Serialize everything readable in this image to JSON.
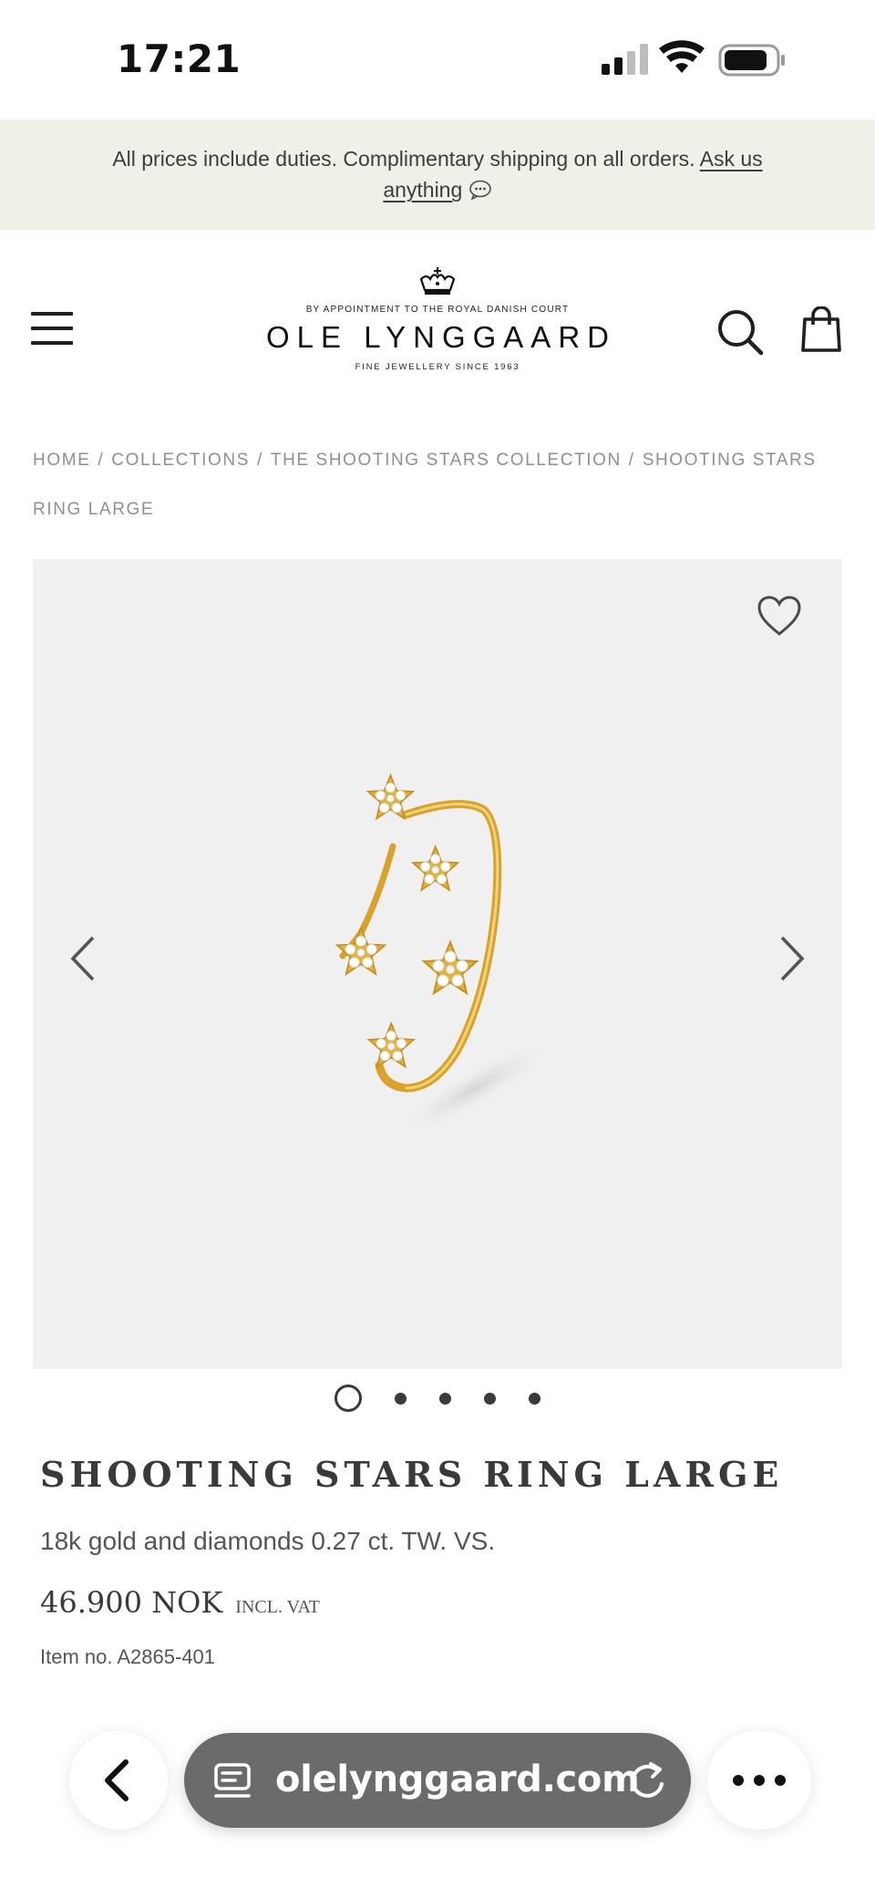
{
  "status_bar": {
    "time": "17:21",
    "icons": [
      "cellular-signal-icon",
      "wifi-icon",
      "battery-icon"
    ]
  },
  "announcement": {
    "text": "All prices include duties. Complimentary shipping on all orders.",
    "link_label": "Ask us anything",
    "link_icon": "chat-bubble-icon"
  },
  "header": {
    "menu_icon": "hamburger-menu-icon",
    "logo": {
      "crown_icon": "royal-crown-icon",
      "appointment": "BY APPOINTMENT TO THE ROYAL DANISH COURT",
      "brand": "OLE LYNGGAARD",
      "tagline": "FINE JEWELLERY SINCE 1963"
    },
    "search_icon": "search-icon",
    "bag_icon": "shopping-bag-icon"
  },
  "breadcrumb": {
    "items": [
      "HOME",
      "COLLECTIONS",
      "THE SHOOTING STARS COLLECTION",
      "SHOOTING STARS RING LARGE"
    ],
    "separator": "/"
  },
  "gallery": {
    "image_subject": "gold ring with diamond star clusters",
    "wishlist_icon": "heart-icon",
    "prev_icon": "chevron-left-icon",
    "next_icon": "chevron-right-icon",
    "slide_count": 5,
    "active_slide": 1
  },
  "product": {
    "title": "SHOOTING STARS RING LARGE",
    "material": "18k gold and diamonds 0.27 ct. TW. VS.",
    "price": "46.900 NOK",
    "vat_note": "INCL. VAT",
    "item_number": "Item no. A2865-401"
  },
  "browser": {
    "url": "olelynggaard.com",
    "back_icon": "chevron-left-icon",
    "tabs_icon": "page-settings-icon",
    "reload_icon": "reload-icon",
    "more_icon": "more-dots-icon"
  },
  "colors": {
    "announcement_bg": "#f0efe8",
    "gallery_bg": "#f0f0f0",
    "gold": "#e3b23c",
    "url_bar": "#6b6b6b"
  }
}
